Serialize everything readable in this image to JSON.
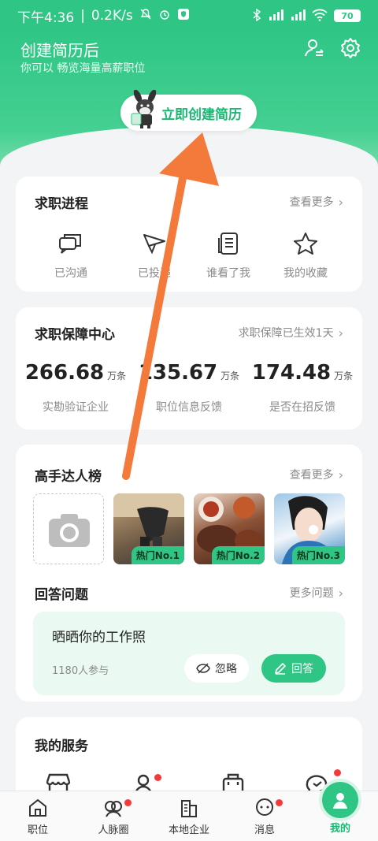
{
  "status_bar": {
    "time": "下午4:36",
    "speed": "0.2K/s",
    "battery": "70"
  },
  "header": {
    "title": "创建简历后",
    "subtitle": "你可以 畅览海量高薪职位",
    "create_button": "立即创建简历"
  },
  "job_progress": {
    "title": "求职进程",
    "more": "查看更多",
    "items": [
      {
        "label": "已沟通",
        "icon": "chat-icon"
      },
      {
        "label": "已投递",
        "icon": "send-icon"
      },
      {
        "label": "谁看了我",
        "icon": "document-icon"
      },
      {
        "label": "我的收藏",
        "icon": "star-icon"
      }
    ]
  },
  "guarantee": {
    "title": "求职保障中心",
    "more": "求职保障已生效1天",
    "stats": [
      {
        "value": "266.68",
        "unit": "万条",
        "label": "实勘验证企业"
      },
      {
        "value": "135.67",
        "unit": "万条",
        "label": "职位信息反馈"
      },
      {
        "value": "174.48",
        "unit": "万条",
        "label": "是否在招反馈"
      }
    ]
  },
  "experts": {
    "title": "高手达人榜",
    "more": "查看更多",
    "items": [
      {
        "badge": "热门No.1"
      },
      {
        "badge": "热门No.2"
      },
      {
        "badge": "热门No.3"
      }
    ]
  },
  "questions": {
    "title": "回答问题",
    "more": "更多问题",
    "question": "晒晒你的工作照",
    "participants": "1180人参与",
    "ignore": "忽略",
    "answer": "回答"
  },
  "services": {
    "title": "我的服务"
  },
  "bottom_nav": [
    {
      "label": "职位",
      "icon": "home-icon"
    },
    {
      "label": "人脉圈",
      "icon": "network-icon"
    },
    {
      "label": "本地企业",
      "icon": "building-icon"
    },
    {
      "label": "消息",
      "icon": "message-icon"
    },
    {
      "label": "我的",
      "icon": "profile-icon"
    }
  ],
  "colors": {
    "brand": "#2fc685",
    "annotation_arrow": "#f47a3c"
  }
}
